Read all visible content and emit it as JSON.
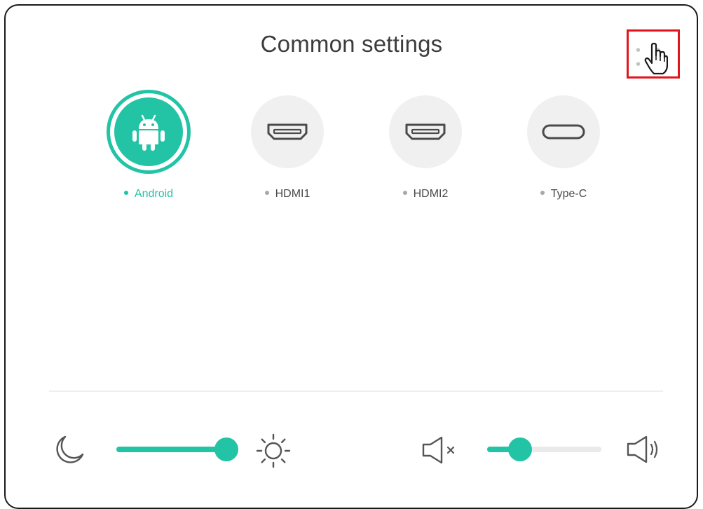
{
  "title": "Common settings",
  "colors": {
    "accent": "#22c4a5",
    "highlight_box": "#e2141c",
    "inactive_circle": "#f0f0f0",
    "track": "#eaeaea"
  },
  "more_button": {
    "icon": "more-dots-icon",
    "dots": "• • •"
  },
  "sources": [
    {
      "label": "Android",
      "icon": "android-icon",
      "active": true
    },
    {
      "label": "HDMI1",
      "icon": "hdmi-port-icon",
      "active": false
    },
    {
      "label": "HDMI2",
      "icon": "hdmi-port-icon",
      "active": false
    },
    {
      "label": "Type-C",
      "icon": "usb-c-port-icon",
      "active": false
    }
  ],
  "brightness": {
    "min_icon": "moon-icon",
    "max_icon": "sun-icon",
    "value_fraction": 0.96
  },
  "volume": {
    "min_icon": "speaker-mute-icon",
    "max_icon": "speaker-loud-icon",
    "value_fraction": 0.29
  }
}
